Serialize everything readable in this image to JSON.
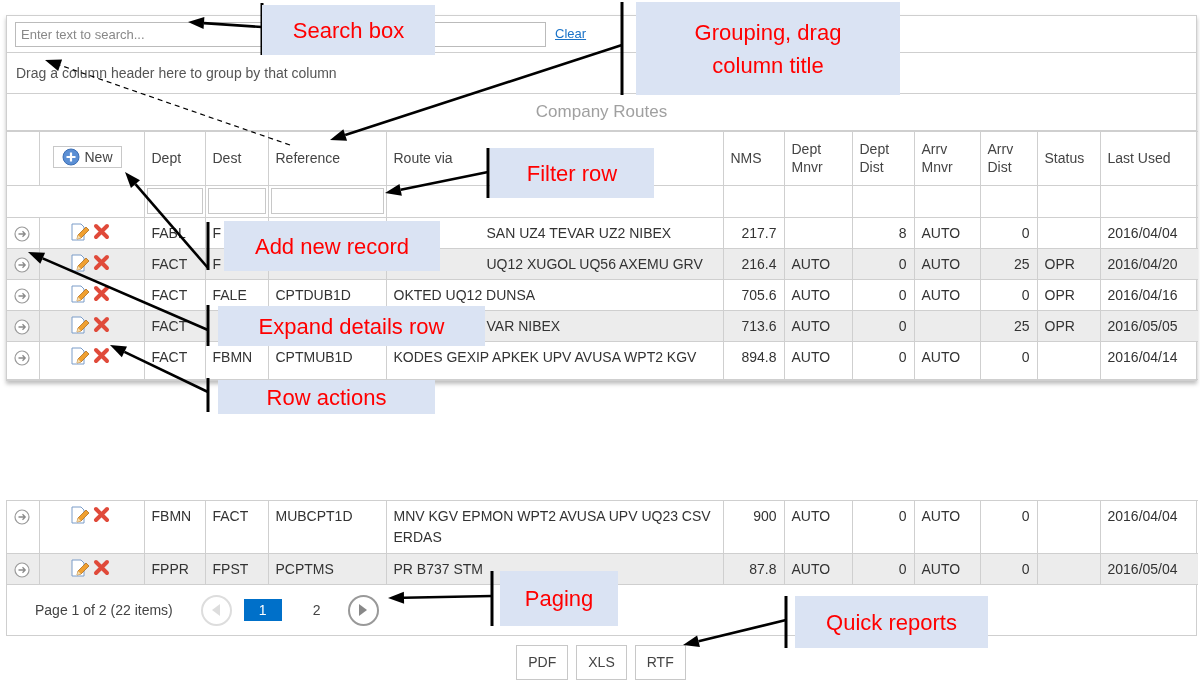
{
  "search": {
    "placeholder": "Enter text to search...",
    "clear_link": "Clear"
  },
  "group_panel": "Drag a column header here to group by that column",
  "grid_title": "Company Routes",
  "new_button": {
    "label": "New"
  },
  "columns": [
    {
      "label": "Dept",
      "kind": "text",
      "filter": true
    },
    {
      "label": "Dest",
      "kind": "text",
      "filter": true
    },
    {
      "label": "Reference",
      "kind": "text",
      "filter": true
    },
    {
      "label": "Route via",
      "kind": "text",
      "filter": false
    },
    {
      "label": "NMS",
      "kind": "number",
      "filter": false
    },
    {
      "label": "Dept Mnvr",
      "kind": "text",
      "filter": false
    },
    {
      "label": "Dept Dist",
      "kind": "number",
      "filter": false
    },
    {
      "label": "Arrv Mnvr",
      "kind": "text",
      "filter": false
    },
    {
      "label": "Arrv Dist",
      "kind": "number",
      "filter": false
    },
    {
      "label": "Status",
      "kind": "text",
      "filter": false
    },
    {
      "label": "Last Used",
      "kind": "text",
      "filter": false
    }
  ],
  "rows": [
    {
      "route_covered": true,
      "cells": [
        "FABL",
        "F",
        null,
        "SAN UZ4 TEVAR UZ2 NIBEX",
        "217.7",
        null,
        "8",
        "AUTO",
        "0",
        null,
        "2016/04/04"
      ]
    },
    {
      "route_covered": true,
      "cells": [
        "FACT",
        "F",
        null,
        "UQ12 XUGOL UQ56 AXEMU GRV",
        "216.4",
        "AUTO",
        "0",
        "AUTO",
        "25",
        "OPR",
        "2016/04/20"
      ]
    },
    {
      "route_covered": false,
      "cells": [
        "FACT",
        "FALE",
        "CPTDUB1D",
        "OKTED UQ12 DUNSA",
        "705.6",
        "AUTO",
        "0",
        "AUTO",
        "0",
        "OPR",
        "2016/04/16"
      ]
    },
    {
      "route_covered": true,
      "cells": [
        "FACT",
        null,
        null,
        "VAR NIBEX",
        "713.6",
        "AUTO",
        "0",
        null,
        "25",
        "OPR",
        "2016/05/05"
      ]
    },
    {
      "route_covered": false,
      "cells": [
        "FACT",
        "FBMN",
        "CPTMUB1D",
        "KODES GEXIP APKEK UPV AVUSA WPT2 KGV",
        "894.8",
        "AUTO",
        "0",
        "AUTO",
        "0",
        null,
        "2016/04/14"
      ]
    }
  ],
  "rows_continued": [
    {
      "route_covered": false,
      "cells": [
        "FBMN",
        "FACT",
        "MUBCPT1D",
        "MNV KGV EPMON WPT2 AVUSA UPV UQ23 CSV ERDAS",
        "900",
        "AUTO",
        "0",
        "AUTO",
        "0",
        null,
        "2016/04/04"
      ]
    },
    {
      "route_covered": false,
      "cells": [
        "FPPR",
        "FPST",
        "PCPTMS",
        "PR B737 STM",
        "87.8",
        "AUTO",
        "0",
        "AUTO",
        "0",
        null,
        "2016/05/04"
      ]
    }
  ],
  "pager": {
    "summary": "Page 1 of 2 (22 items)",
    "prev": {
      "disabled": true
    },
    "next": {
      "disabled": false
    },
    "pages": [
      {
        "label": "1",
        "selected": true
      },
      {
        "label": "2",
        "selected": false
      }
    ]
  },
  "reports": [
    "PDF",
    "XLS",
    "RTF"
  ],
  "callouts": [
    {
      "text": "Search box"
    },
    {
      "text": "Grouping, drag column title"
    },
    {
      "text": "Filter row"
    },
    {
      "text": "Add new record"
    },
    {
      "text": "Expand details row"
    },
    {
      "text": "Row actions"
    },
    {
      "text": "Paging"
    },
    {
      "text": "Quick reports"
    }
  ]
}
